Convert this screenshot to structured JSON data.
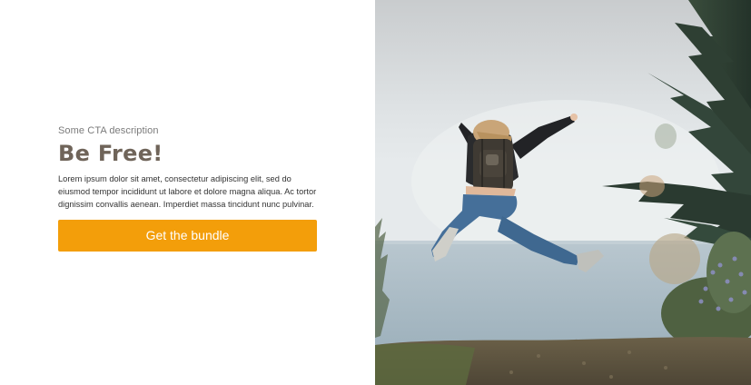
{
  "cta_section": {
    "eyebrow": "Some CTA description",
    "title": "Be Free!",
    "body": "Lorem ipsum dolor sit amet, consectetur adipiscing elit, sed do eiusmod tempor incididunt ut labore et dolore magna aliqua. Ac tortor dignissim convallis aenean. Imperdiet massa tincidunt nunc pulvinar.",
    "button_label": "Get the bundle"
  },
  "colors": {
    "accent": "#f39e0a",
    "title": "#6f6459",
    "body_text": "#333333",
    "eyebrow_text": "#7b7b7b",
    "background": "#ffffff"
  },
  "hero_image": {
    "subject": "person-jumping-photo"
  }
}
